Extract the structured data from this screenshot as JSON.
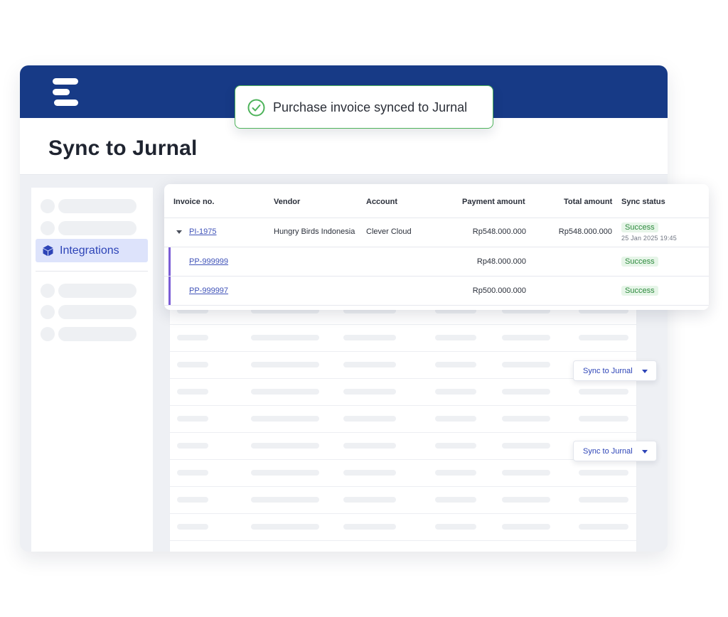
{
  "toast": {
    "message": "Purchase invoice synced to Jurnal",
    "icon": "check-circle-icon",
    "accent": "#4db35a"
  },
  "header": {
    "logo": "logo-icon",
    "brand_color": "#173a86"
  },
  "page": {
    "title": "Sync to Jurnal"
  },
  "sidebar": {
    "active_item": {
      "label": "Integrations",
      "icon": "cube-icon",
      "accent": "#2d44b7"
    }
  },
  "table": {
    "columns": [
      "Invoice no.",
      "Vendor",
      "Account",
      "Payment amount",
      "Total amount",
      "Sync status"
    ],
    "rows": [
      {
        "invoice": "PI-1975",
        "vendor": "Hungry Birds Indonesia",
        "account": "Clever Cloud",
        "payment": "Rp548.000.000",
        "total": "Rp548.000.000",
        "status": "Success",
        "timestamp": "25 Jan 2025 19:45",
        "expanded": true
      },
      {
        "invoice": "PP-999999",
        "payment": "Rp48.000.000",
        "status": "Success"
      },
      {
        "invoice": "PP-999997",
        "payment": "Rp500.000.000",
        "status": "Success"
      }
    ]
  },
  "actions": {
    "sync_label": "Sync to Jurnal"
  }
}
